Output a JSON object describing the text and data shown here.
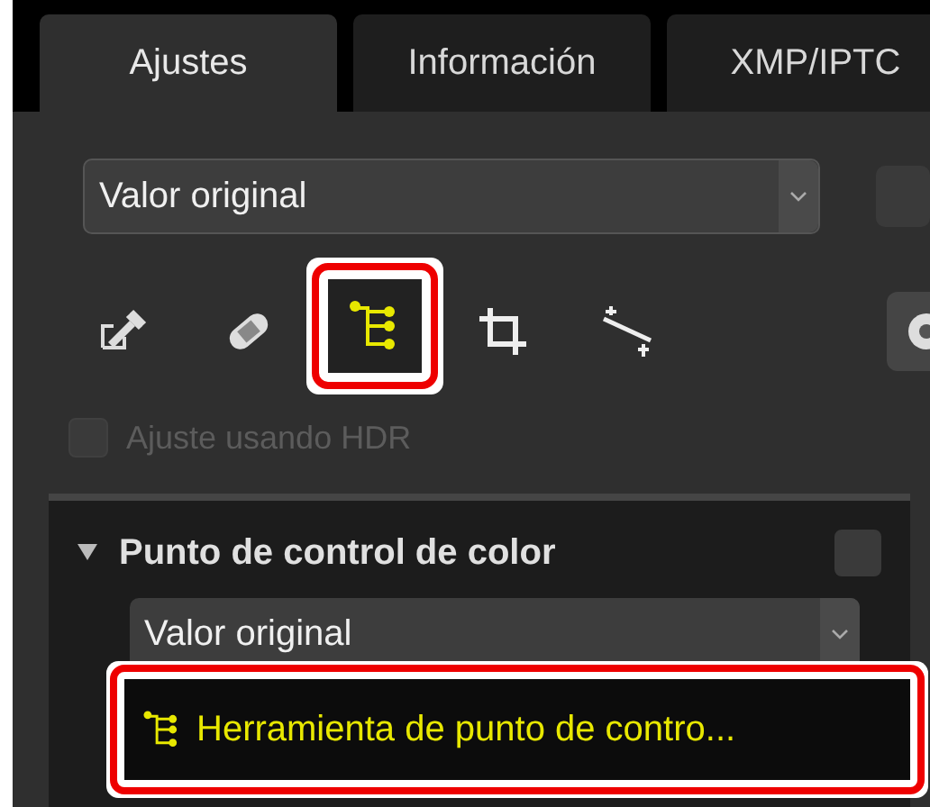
{
  "tabs": [
    {
      "label": "Ajustes",
      "selected": true
    },
    {
      "label": "Información",
      "selected": false
    },
    {
      "label": "XMP/IPTC",
      "selected": false
    }
  ],
  "preset": {
    "value": "Valor original"
  },
  "tools": [
    {
      "kind": "eyedropper",
      "selected": false,
      "highlighted": false
    },
    {
      "kind": "retouch",
      "selected": false,
      "highlighted": false
    },
    {
      "kind": "controlpoint",
      "selected": true,
      "highlighted": true
    },
    {
      "kind": "crop",
      "selected": false,
      "highlighted": false
    },
    {
      "kind": "straighten",
      "selected": false,
      "highlighted": false
    }
  ],
  "hdr": {
    "label": "Ajuste usando HDR",
    "checked": false,
    "disabled": true
  },
  "section": {
    "title": "Punto de control de color",
    "expanded": true,
    "checked": false,
    "preset": {
      "value": "Valor original"
    },
    "tool_button": {
      "label": "Herramienta de punto de contro...",
      "highlighted": true
    }
  }
}
